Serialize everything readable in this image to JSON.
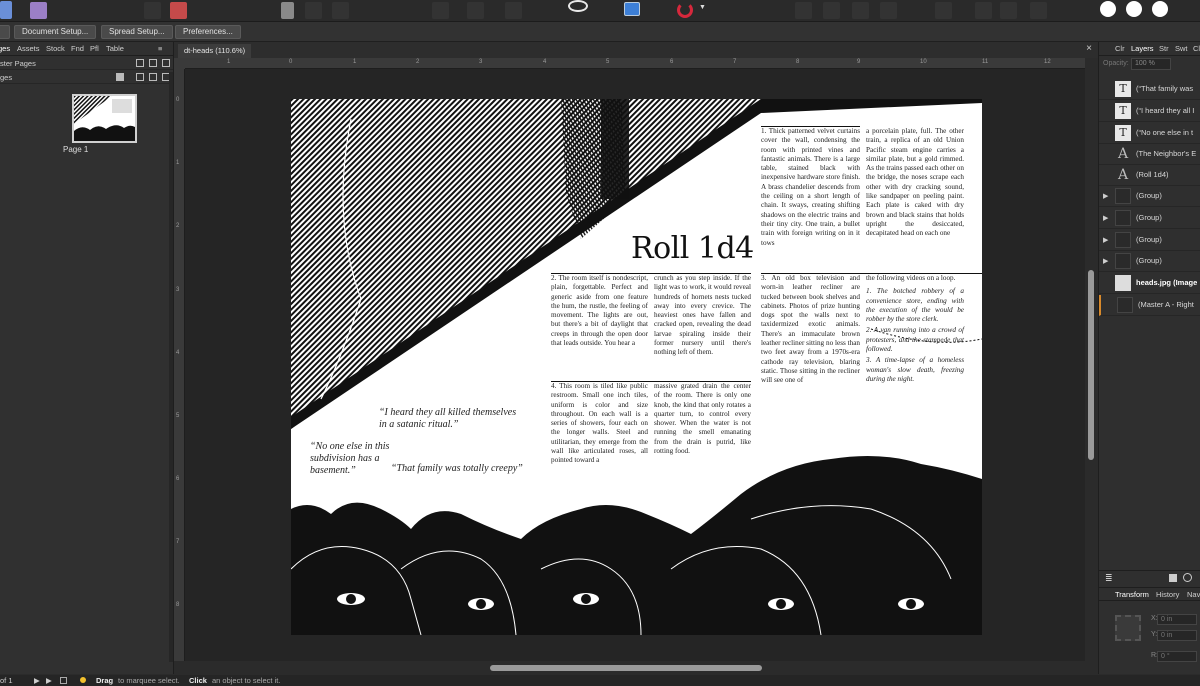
{
  "context_bar": {
    "buttons": [
      "Document Setup...",
      "Spread Setup...",
      "Preferences..."
    ]
  },
  "left_panel": {
    "tabs": [
      "ges",
      "Assets",
      "Stock",
      "Fnd",
      "Pfl",
      "Table"
    ],
    "master_pages_label": "ster Pages",
    "pages_label": "ges",
    "page_thumb_label": "Page 1"
  },
  "document": {
    "tab_title": "dt-heads (110.6%)",
    "close_glyph": "×",
    "ruler_h": [
      "1",
      "0",
      "1",
      "2",
      "3",
      "4",
      "5",
      "6",
      "7",
      "8",
      "9",
      "10",
      "11",
      "12"
    ],
    "ruler_v": [
      "0",
      "1",
      "2",
      "3",
      "4",
      "5",
      "6",
      "7",
      "8"
    ]
  },
  "page": {
    "title": "Roll 1d4",
    "col1_top": "1. Thick patterned velvet curtains cover the wall, condensing the room with printed vines and fantastic animals. There is a large table, stained black with inexpensive hardware store finish. A brass chandelier descends from the ceiling on a short length of chain. It sways, creating shifting shadows on the electric trains and their tiny city. One train, a bullet train with foreign writing on in it tows",
    "col2_top": "a porcelain plate, full. The other train, a replica of an old Union Pacific steam engine carries a similar plate, but a gold rimmed. As the trains passed each other on the bridge, the noses scrape each other with dry cracking sound, like sandpaper on peeling paint. Each plate is caked with dry brown and black stains that holds upright the desiccated, decapitated head on each one",
    "col_a_mid": "2. The room itself is nondescript, plain, forgettable. Perfect and generic aside from one feature the hum, the rustle, the feeling of movement. The lights are out, but there's a bit of daylight that creeps in through the open door that leads outside. You hear a",
    "col_b_mid": "crunch as you step inside. If the light was to work, it would reveal hundreds of hornets nests tucked away into every crevice. The heaviest ones have fallen and cracked open, revealing the dead larvae spiraling inside their former nursery until there's nothing left of them.",
    "col1_mid": "3. An old box television and worn-in leather recliner are tucked between book shelves and cabinets. Photos of prize hunting dogs spot the walls next to taxidermized exotic animals. There's an immaculate brown leather recliner sitting no less than two feet away from a 1970s-era cathode ray television, blaring static. Those sitting in the recliner will see one of",
    "col2_mid_intro": "the following videos on a loop.",
    "col2_mid_items": [
      "1. The botched robbery of a convenience store, ending with the execution of the would be robber by the store clerk.",
      "2. A van running into a crowd of protesters, and the stampede that followed.",
      "3. A time-lapse of a homeless woman's slow death, freezing during the night."
    ],
    "col_a_bot": "4. This room is tiled like public restroom. Small one inch tiles, uniform is color and size throughout. On each wall is a series of showers, four each on the longer walls. Steel and utilitarian, they emerge from the wall like articulated roses, all pointed toward a",
    "col_b_bot": "massive grated drain the center of the room. There is only one knob, the kind that only rotates a quarter turn, to control every shower. When the water is not running the smell emanating from the drain is putrid, like rotting food.",
    "quote1": "“I heard they all killed themselves in a satanic ritual.”",
    "quote2": "“No one else in this subdivision has a basement.”",
    "quote3": "“That family was totally creepy”"
  },
  "right_panel": {
    "tabs": [
      "Clr",
      "Layers",
      "Str",
      "Swt",
      "Cl"
    ],
    "opacity_label": "Opacity:",
    "opacity_value": "100 %",
    "layers": [
      {
        "name": "(“That family was",
        "thumb": "T"
      },
      {
        "name": "(“I heard they all I",
        "thumb": "T"
      },
      {
        "name": "(“No one else in t",
        "thumb": "T"
      },
      {
        "name": "(The Neighbor's E",
        "thumb": "A"
      },
      {
        "name": "(Roll 1d4)",
        "thumb": "A"
      },
      {
        "name": "(Group)",
        "thumb": ""
      },
      {
        "name": "(Group)",
        "thumb": ""
      },
      {
        "name": "(Group)",
        "thumb": ""
      },
      {
        "name": "(Group)",
        "thumb": ""
      },
      {
        "name": "heads.jpg (Image",
        "thumb": ""
      },
      {
        "name": "(Master A - Right",
        "thumb": ""
      }
    ],
    "bottom_tabs": [
      "Transform",
      "History",
      "Navi"
    ],
    "transform": {
      "x": "0 in",
      "y": "0 in",
      "r": "0 °",
      "x_label": "X:",
      "y_label": "Y:",
      "r_label": "R:"
    }
  },
  "status_bar": {
    "page_of": "of 1",
    "hint_bold1": "Drag",
    "hint1": "to marquee select.",
    "hint_bold2": "Click",
    "hint2": "an object to select it."
  }
}
